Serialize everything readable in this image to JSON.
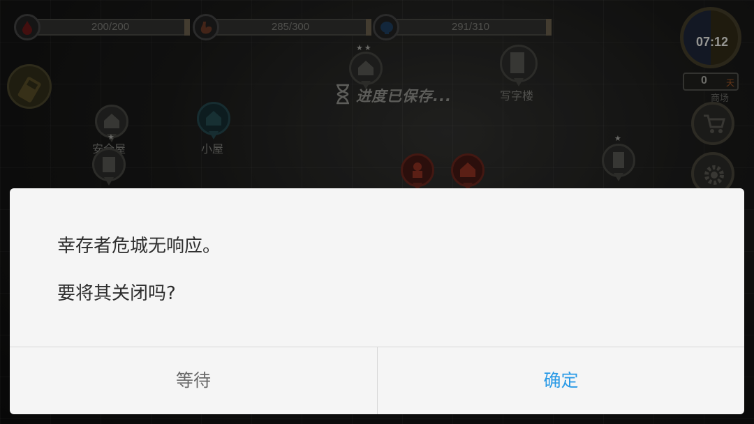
{
  "hud": {
    "health": {
      "value": "200/200",
      "color": "#b02020"
    },
    "hunger": {
      "value": "285/300",
      "color": "#c2603a"
    },
    "mind": {
      "value": "291/310",
      "color": "#2a70c0"
    },
    "clock": "07:12",
    "days": {
      "count": "0",
      "unit": "天"
    },
    "shop_label": "商场"
  },
  "map": {
    "saving_text": "进度已保存...",
    "places": {
      "safehouse": "安全屋",
      "cabin": "小屋",
      "office": "写字楼"
    }
  },
  "dialog": {
    "message": "幸存者危城无响应。",
    "question": "要将其关闭吗?",
    "wait_button": "等待",
    "confirm_button": "确定",
    "confirm_color": "#2a9ae6"
  }
}
